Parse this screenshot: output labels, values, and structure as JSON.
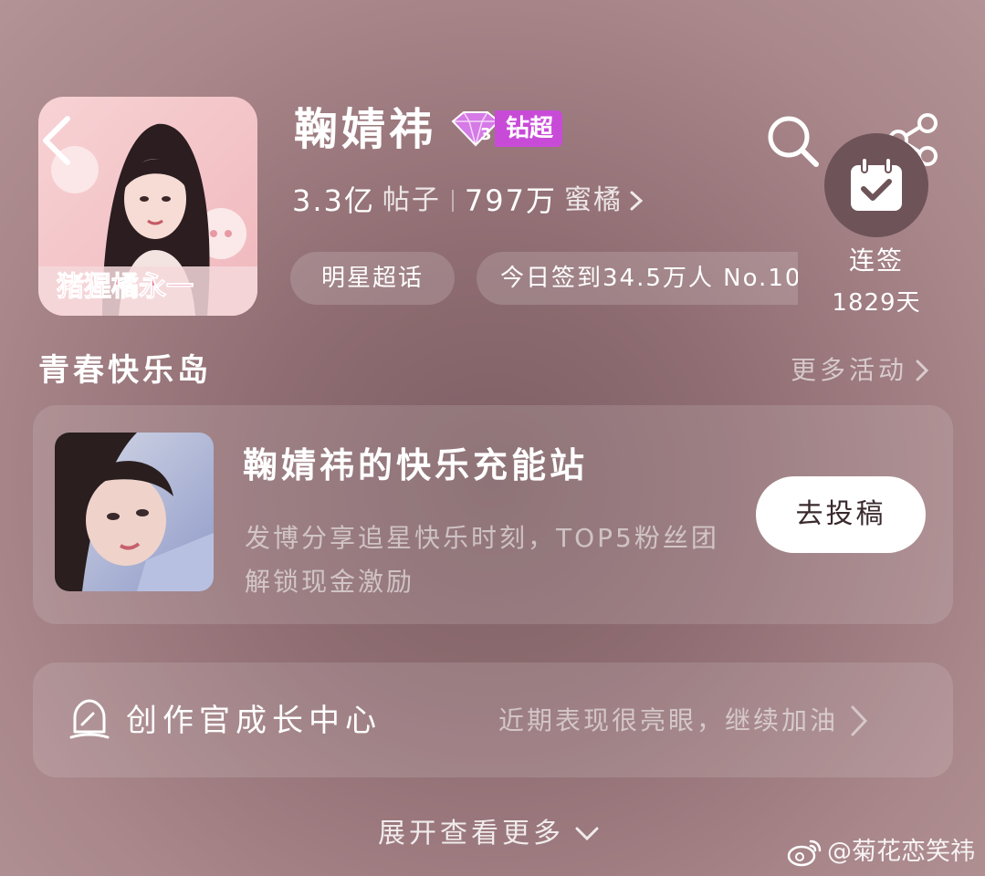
{
  "header": {
    "title": "鞠婧祎",
    "badge": {
      "level": "3",
      "label": "钻超",
      "color": "#c84bd8"
    },
    "stats": {
      "posts_count": "3.3亿",
      "posts_label": "帖子",
      "fans_count": "797万",
      "fans_label": "蜜橘"
    },
    "chips": {
      "category": "明星超话",
      "checkin_today": "今日签到34.5万人 No.10"
    },
    "cover_caption": "猪猩橘永一",
    "checkin": {
      "label": "连签",
      "days": "1829天"
    },
    "icons": [
      "back-arrow-icon",
      "search-icon",
      "share-icon",
      "calendar-check-icon"
    ]
  },
  "section": {
    "title": "青春快乐岛",
    "more_label": "更多活动"
  },
  "activity_card": {
    "title": "鞠婧祎的快乐充能站",
    "description": "发博分享追星快乐时刻，TOP5粉丝团解锁现金激励",
    "button_label": "去投稿"
  },
  "creator_card": {
    "title": "创作官成长中心",
    "status": "近期表现很亮眼，继续加油"
  },
  "expand_label": "展开查看更多",
  "watermark": "@菊花恋笑祎",
  "colors": {
    "background": "#8f6d72",
    "accent_badge": "#c84bd8",
    "button_bg": "#ffffff"
  }
}
